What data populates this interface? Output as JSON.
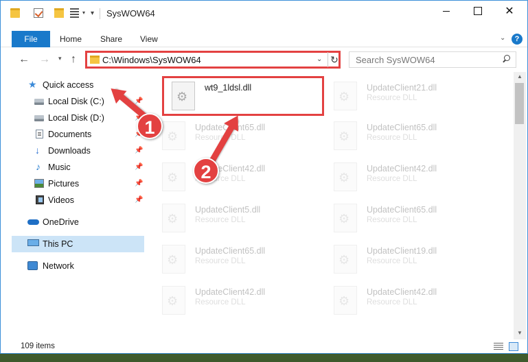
{
  "window": {
    "title": "SysWOW64",
    "controls": {
      "minimize": "—",
      "maximize": "☐",
      "close": "✕"
    }
  },
  "ribbon": {
    "tabs": [
      {
        "label": "File"
      },
      {
        "label": "Home"
      },
      {
        "label": "Share"
      },
      {
        "label": "View"
      }
    ]
  },
  "address_bar": {
    "path": "C:\\Windows\\SysWOW64",
    "search_placeholder": "Search SysWOW64"
  },
  "sidebar": {
    "items": [
      {
        "label": "Quick access",
        "icon": "star-icon"
      },
      {
        "label": "Local Disk (C:)",
        "icon": "disk-icon",
        "pinned": true
      },
      {
        "label": "Local Disk (D:)",
        "icon": "disk-icon",
        "pinned": true
      },
      {
        "label": "Documents",
        "icon": "documents-icon",
        "pinned": true
      },
      {
        "label": "Downloads",
        "icon": "downloads-icon",
        "pinned": true
      },
      {
        "label": "Music",
        "icon": "music-icon",
        "pinned": true
      },
      {
        "label": "Pictures",
        "icon": "pictures-icon",
        "pinned": true
      },
      {
        "label": "Videos",
        "icon": "videos-icon",
        "pinned": true
      },
      {
        "label": "OneDrive",
        "icon": "onedrive-icon"
      },
      {
        "label": "This PC",
        "icon": "pc-icon",
        "selected": true
      },
      {
        "label": "Network",
        "icon": "network-icon"
      }
    ]
  },
  "files": [
    {
      "name": "wt9_1ldsl.dll",
      "desc": "",
      "highlighted": true
    },
    {
      "name": "UpdateClient21.dll",
      "desc": "Resource DLL"
    },
    {
      "name": "UpdateClient65.dll",
      "desc": "Resource DLL"
    },
    {
      "name": "UpdateClient65.dll",
      "desc": "Resource DLL"
    },
    {
      "name": "UpdateClient42.dll",
      "desc": "Resource DLL"
    },
    {
      "name": "UpdateClient42.dll",
      "desc": "Resource DLL"
    },
    {
      "name": "UpdateClient5.dll",
      "desc": "Resource DLL"
    },
    {
      "name": "UpdateClient65.dll",
      "desc": "Resource DLL"
    },
    {
      "name": "UpdateClient65.dll",
      "desc": "Resource DLL"
    },
    {
      "name": "UpdateClient19.dll",
      "desc": "Resource DLL"
    },
    {
      "name": "UpdateClient42.dll",
      "desc": "Resource DLL"
    },
    {
      "name": "UpdateClient42.dll",
      "desc": "Resource DLL"
    }
  ],
  "status": {
    "item_count": "109 items"
  },
  "annotations": {
    "markers": [
      "1",
      "2"
    ],
    "accent_color": "#e34141"
  },
  "colors": {
    "file_tab": "#1979ca",
    "selection": "#cce4f7"
  }
}
